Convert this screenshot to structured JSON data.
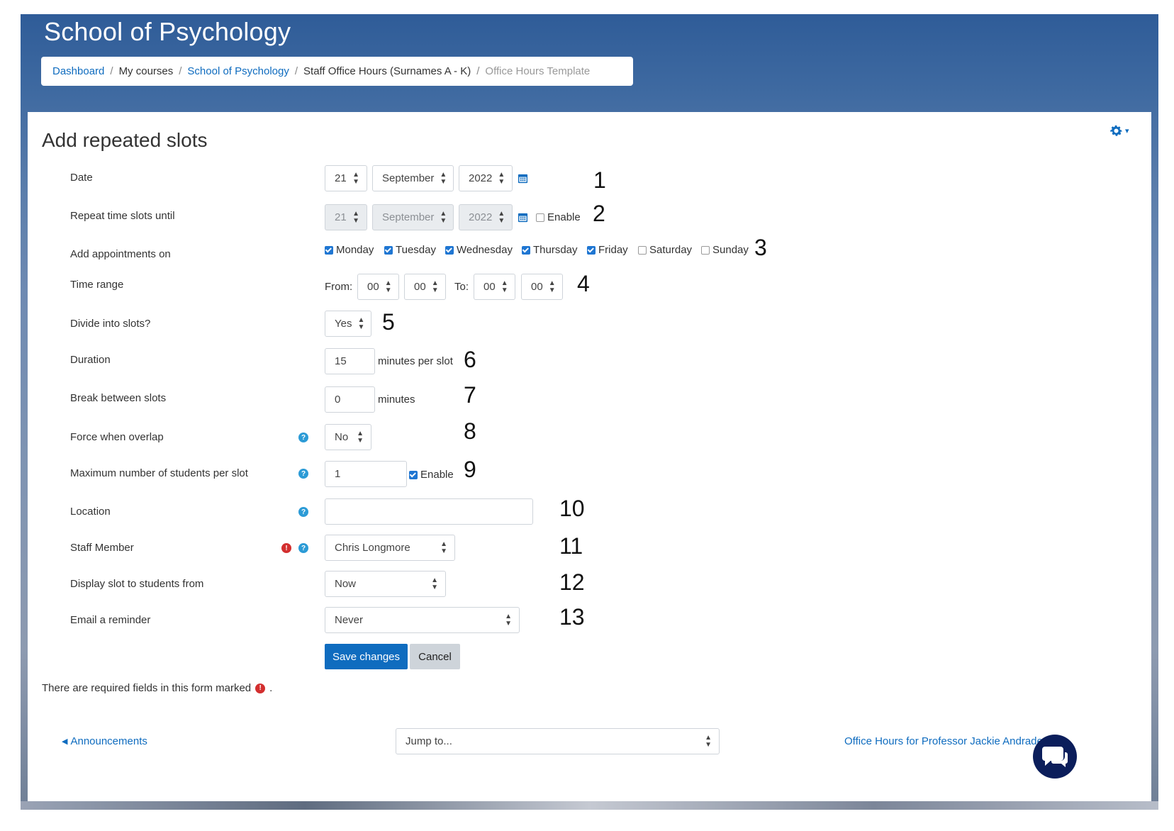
{
  "site_title": "School of Psychology",
  "breadcrumb": [
    {
      "label": "Dashboard",
      "style": "link"
    },
    {
      "label": "My courses",
      "style": "plain"
    },
    {
      "label": "School of Psychology",
      "style": "link"
    },
    {
      "label": "Staff Office Hours (Surnames A - K)",
      "style": "plain"
    },
    {
      "label": "Office Hours Template",
      "style": "muted"
    }
  ],
  "heading": "Add repeated slots",
  "icons": {
    "settings": "gear-icon",
    "calendar": "calendar-icon",
    "help": "help-icon",
    "required": "required-icon",
    "chat": "chat-icon"
  },
  "form": {
    "date": {
      "label": "Date",
      "day": "21",
      "month": "September",
      "year": "2022"
    },
    "repeat_until": {
      "label": "Repeat time slots until",
      "day": "21",
      "month": "September",
      "year": "2022",
      "enable_label": "Enable",
      "enabled": false
    },
    "appointments_on": {
      "label": "Add appointments on",
      "days": [
        {
          "name": "Monday",
          "checked": true
        },
        {
          "name": "Tuesday",
          "checked": true
        },
        {
          "name": "Wednesday",
          "checked": true
        },
        {
          "name": "Thursday",
          "checked": true
        },
        {
          "name": "Friday",
          "checked": true
        },
        {
          "name": "Saturday",
          "checked": false
        },
        {
          "name": "Sunday",
          "checked": false
        }
      ]
    },
    "time_range": {
      "label": "Time range",
      "from_label": "From:",
      "from_hour": "00",
      "from_min": "00",
      "to_label": "To:",
      "to_hour": "00",
      "to_min": "00"
    },
    "divide": {
      "label": "Divide into slots?",
      "value": "Yes"
    },
    "duration": {
      "label": "Duration",
      "value": "15",
      "suffix": "minutes per slot"
    },
    "break": {
      "label": "Break between slots",
      "value": "0",
      "suffix": "minutes"
    },
    "force_overlap": {
      "label": "Force when overlap",
      "value": "No"
    },
    "max_students": {
      "label": "Maximum number of students per slot",
      "value": "1",
      "enable_label": "Enable",
      "enabled": true
    },
    "location": {
      "label": "Location",
      "value": ""
    },
    "staff_member": {
      "label": "Staff Member",
      "value": "Chris Longmore"
    },
    "display_from": {
      "label": "Display slot to students from",
      "value": "Now"
    },
    "email_reminder": {
      "label": "Email a reminder",
      "value": "Never"
    }
  },
  "annotations": [
    "1",
    "2",
    "3",
    "4",
    "5",
    "6",
    "7",
    "8",
    "9",
    "10",
    "11",
    "12",
    "13"
  ],
  "buttons": {
    "save": "Save changes",
    "cancel": "Cancel"
  },
  "required_note": "There are required fields in this form marked",
  "required_note_end": ".",
  "footer": {
    "prev_link": "Announcements",
    "jump_placeholder": "Jump to...",
    "next_link": "Office Hours for Professor Jackie Andrade"
  }
}
